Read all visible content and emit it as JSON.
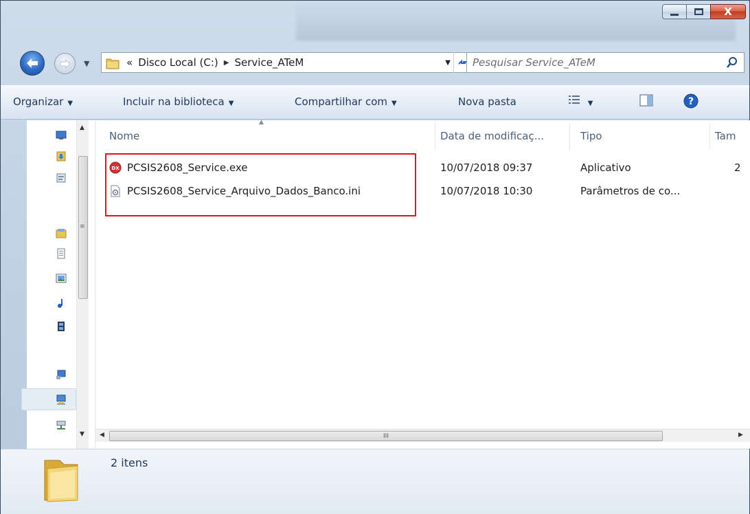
{
  "window": {
    "close_glyph": "X"
  },
  "address": {
    "chevron": "«",
    "crumbs": [
      "Disco Local (C:)",
      "Service_ATeM"
    ]
  },
  "search": {
    "placeholder": "Pesquisar Service_ATeM"
  },
  "toolbar": {
    "organize": "Organizar",
    "include": "Incluir na biblioteca",
    "share": "Compartilhar com",
    "new_folder": "Nova pasta"
  },
  "columns": {
    "name": "Nome",
    "date": "Data de modificaç...",
    "type": "Tipo",
    "size": "Tam"
  },
  "files": [
    {
      "name": "PCSIS2608_Service.exe",
      "date": "10/07/2018 09:37",
      "type": "Aplicativo",
      "size": "2",
      "icon": "exe-app-icon"
    },
    {
      "name": "PCSIS2608_Service_Arquivo_Dados_Banco.ini",
      "date": "10/07/2018 10:30",
      "type": "Parâmetros de co...",
      "size": "",
      "icon": "ini-settings-icon"
    }
  ],
  "scroll": {
    "grip": "III"
  },
  "status": {
    "count": "2 itens"
  },
  "colors": {
    "highlight": "#e0141e",
    "titlebar": "#c2d3e5",
    "toolbar": "#e4ecf6"
  }
}
